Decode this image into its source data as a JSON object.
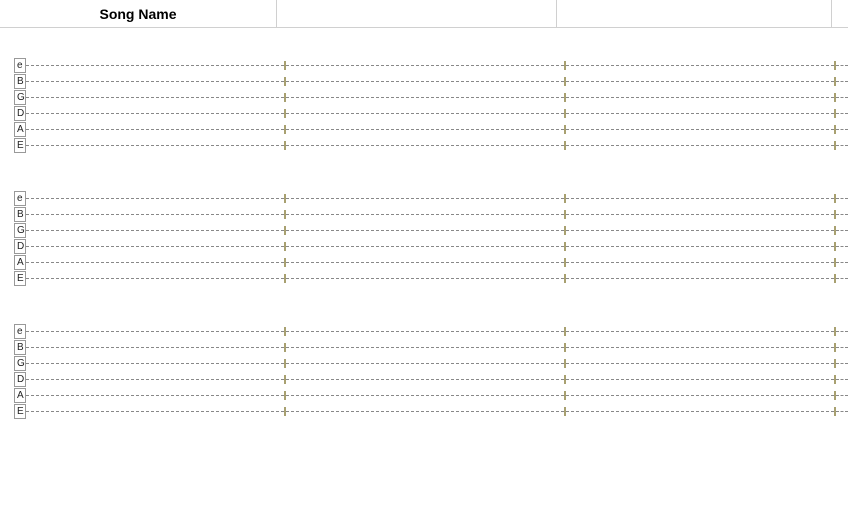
{
  "header": {
    "col1": "Song Name",
    "col2": "",
    "col3": "",
    "col4": ""
  },
  "strings": [
    "e",
    "B",
    "G",
    "D",
    "A",
    "E"
  ],
  "tab_blocks": 3,
  "measures_per_line": 3
}
